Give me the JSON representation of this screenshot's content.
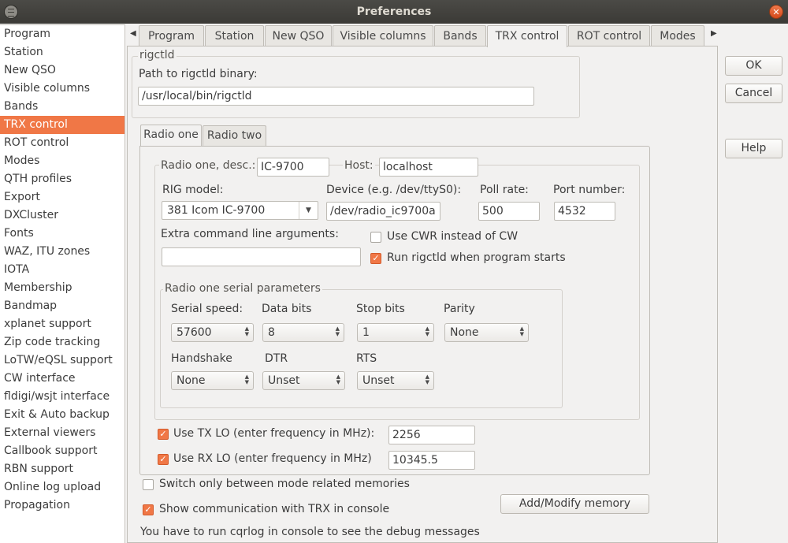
{
  "window": {
    "title": "Preferences"
  },
  "sidebar": {
    "items": [
      "Program",
      "Station",
      "New QSO",
      "Visible columns",
      "Bands",
      "TRX control",
      "ROT control",
      "Modes",
      "QTH profiles",
      "Export",
      "DXCluster",
      "Fonts",
      "WAZ, ITU zones",
      "IOTA",
      "Membership",
      "Bandmap",
      "xplanet support",
      "Zip code tracking",
      "LoTW/eQSL support",
      "CW interface",
      "fldigi/wsjt interface",
      "Exit & Auto backup",
      "External viewers",
      "Callbook support",
      "RBN support",
      "Online log upload",
      "Propagation"
    ],
    "selected": "TRX control"
  },
  "tabs": [
    "Program",
    "Station",
    "New QSO",
    "Visible columns",
    "Bands",
    "TRX control",
    "ROT control",
    "Modes"
  ],
  "active_tab": "TRX control",
  "rigctld": {
    "group_label": "rigctld",
    "path_label": "Path to rigctld binary:",
    "path_value": "/usr/local/bin/rigctld"
  },
  "radio_tabs": [
    "Radio one",
    "Radio two"
  ],
  "radio": {
    "desc_label": "Radio one, desc.:",
    "desc_value": "IC-9700",
    "host_label": "Host:",
    "host_value": "localhost",
    "rig_model_label": "RIG model:",
    "rig_model_value": "381 Icom IC-9700",
    "device_label": "Device (e.g. /dev/ttyS0):",
    "device_value": "/dev/radio_ic9700a",
    "poll_label": "Poll rate:",
    "poll_value": "500",
    "port_label": "Port number:",
    "port_value": "4532",
    "extra_label": "Extra command line arguments:",
    "extra_value": "",
    "cwr_label": "Use CWR instead of CW",
    "cwr_checked": false,
    "run_label": "Run rigctld when program starts",
    "run_checked": true
  },
  "serial": {
    "group_label": "Radio one serial parameters",
    "speed_label": "Serial speed:",
    "speed_value": "57600",
    "databits_label": "Data bits",
    "databits_value": "8",
    "stopbits_label": "Stop bits",
    "stopbits_value": "1",
    "parity_label": "Parity",
    "parity_value": "None",
    "handshake_label": "Handshake",
    "handshake_value": "None",
    "dtr_label": "DTR",
    "dtr_value": "Unset",
    "rts_label": "RTS",
    "rts_value": "Unset"
  },
  "lo": {
    "tx_label": "Use TX LO (enter frequency in MHz):",
    "tx_checked": true,
    "tx_value": "2256",
    "rx_label": "Use RX LO (enter frequency in MHz)",
    "rx_checked": true,
    "rx_value": "10345.5"
  },
  "bottom": {
    "switch_label": "Switch only between mode related memories",
    "switch_checked": false,
    "show_label": "Show communication with TRX in console",
    "show_checked": true,
    "add_memory_label": "Add/Modify memory",
    "debug_note": "You have to run cqrlog in console to see the debug messages"
  },
  "buttons": {
    "ok": "OK",
    "cancel": "Cancel",
    "help": "Help"
  }
}
